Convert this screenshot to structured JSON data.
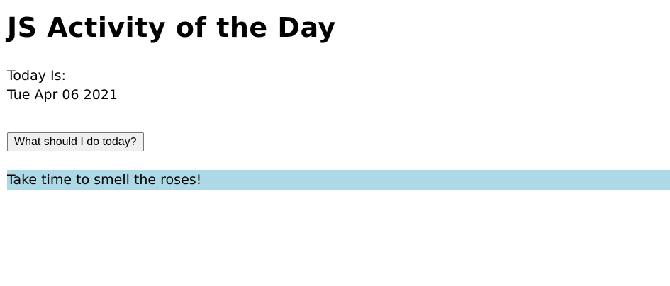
{
  "header": {
    "title": "JS Activity of the Day"
  },
  "date_section": {
    "label": "Today Is:",
    "value": "Tue Apr 06 2021"
  },
  "action": {
    "button_label": "What should I do today?"
  },
  "result": {
    "text": "Take time to smell the roses!",
    "background_color": "#add8e6"
  },
  "colors": {
    "page_background": "#ffffff",
    "text": "#000000",
    "button_background": "#efefef",
    "button_border": "#767676"
  }
}
